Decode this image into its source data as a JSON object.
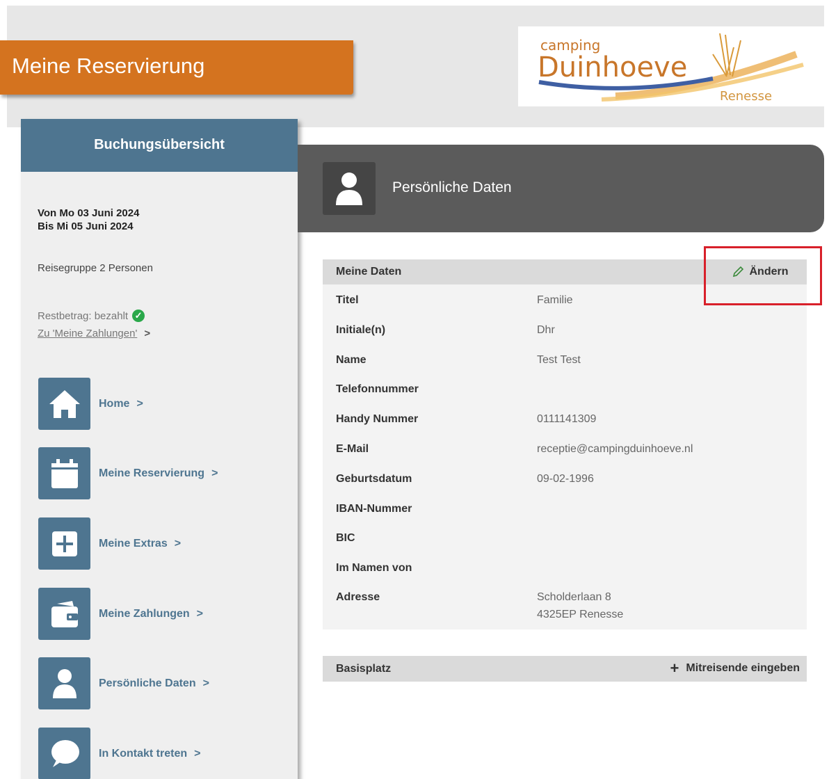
{
  "header": {
    "title": "Meine Reservierung",
    "logo": {
      "top": "camping",
      "name": "Duinhoeve",
      "place": "Renesse"
    }
  },
  "sidebar": {
    "heading": "Buchungsübersicht",
    "date_from": "Von Mo 03 Juni 2024",
    "date_to": "Bis Mi 05 Juni 2024",
    "group": "Reisegruppe 2 Personen",
    "balance": "Restbetrag: bezahlt",
    "payments_link": "Zu 'Meine Zahlungen'",
    "nav": [
      {
        "label": "Home",
        "icon": "home-icon"
      },
      {
        "label": "Meine Reservierung",
        "icon": "calendar-icon"
      },
      {
        "label": "Meine Extras",
        "icon": "plus-icon"
      },
      {
        "label": "Meine Zahlungen",
        "icon": "wallet-icon"
      },
      {
        "label": "Persönliche Daten",
        "icon": "person-icon"
      },
      {
        "label": "In Kontakt treten",
        "icon": "chat-icon"
      }
    ]
  },
  "main": {
    "section_title": "Persönliche Daten",
    "panel_title": "Meine Daten",
    "edit_label": "Ändern",
    "fields": [
      {
        "label": "Titel",
        "value": "Familie"
      },
      {
        "label": "Initiale(n)",
        "value": "Dhr"
      },
      {
        "label": "Name",
        "value": "Test Test"
      },
      {
        "label": "Telefonnummer",
        "value": ""
      },
      {
        "label": "Handy Nummer",
        "value": "0111141309"
      },
      {
        "label": "E-Mail",
        "value": "receptie@campingduinhoeve.nl"
      },
      {
        "label": "Geburtsdatum",
        "value": "09-02-1996"
      },
      {
        "label": "IBAN-Nummer",
        "value": ""
      },
      {
        "label": "BIC",
        "value": ""
      },
      {
        "label": "Im Namen von",
        "value": ""
      },
      {
        "label": "Adresse",
        "value": "Scholderlaan 8",
        "value2": "4325EP Renesse"
      }
    ],
    "basis_title": "Basisplatz",
    "basis_action": "Mitreisende eingeben"
  },
  "colors": {
    "accent_orange": "#d4731f",
    "nav_blue": "#4e7590",
    "header_gray": "#5b5b5b",
    "highlight_red": "#d8202a",
    "check_green": "#2aa84a"
  }
}
